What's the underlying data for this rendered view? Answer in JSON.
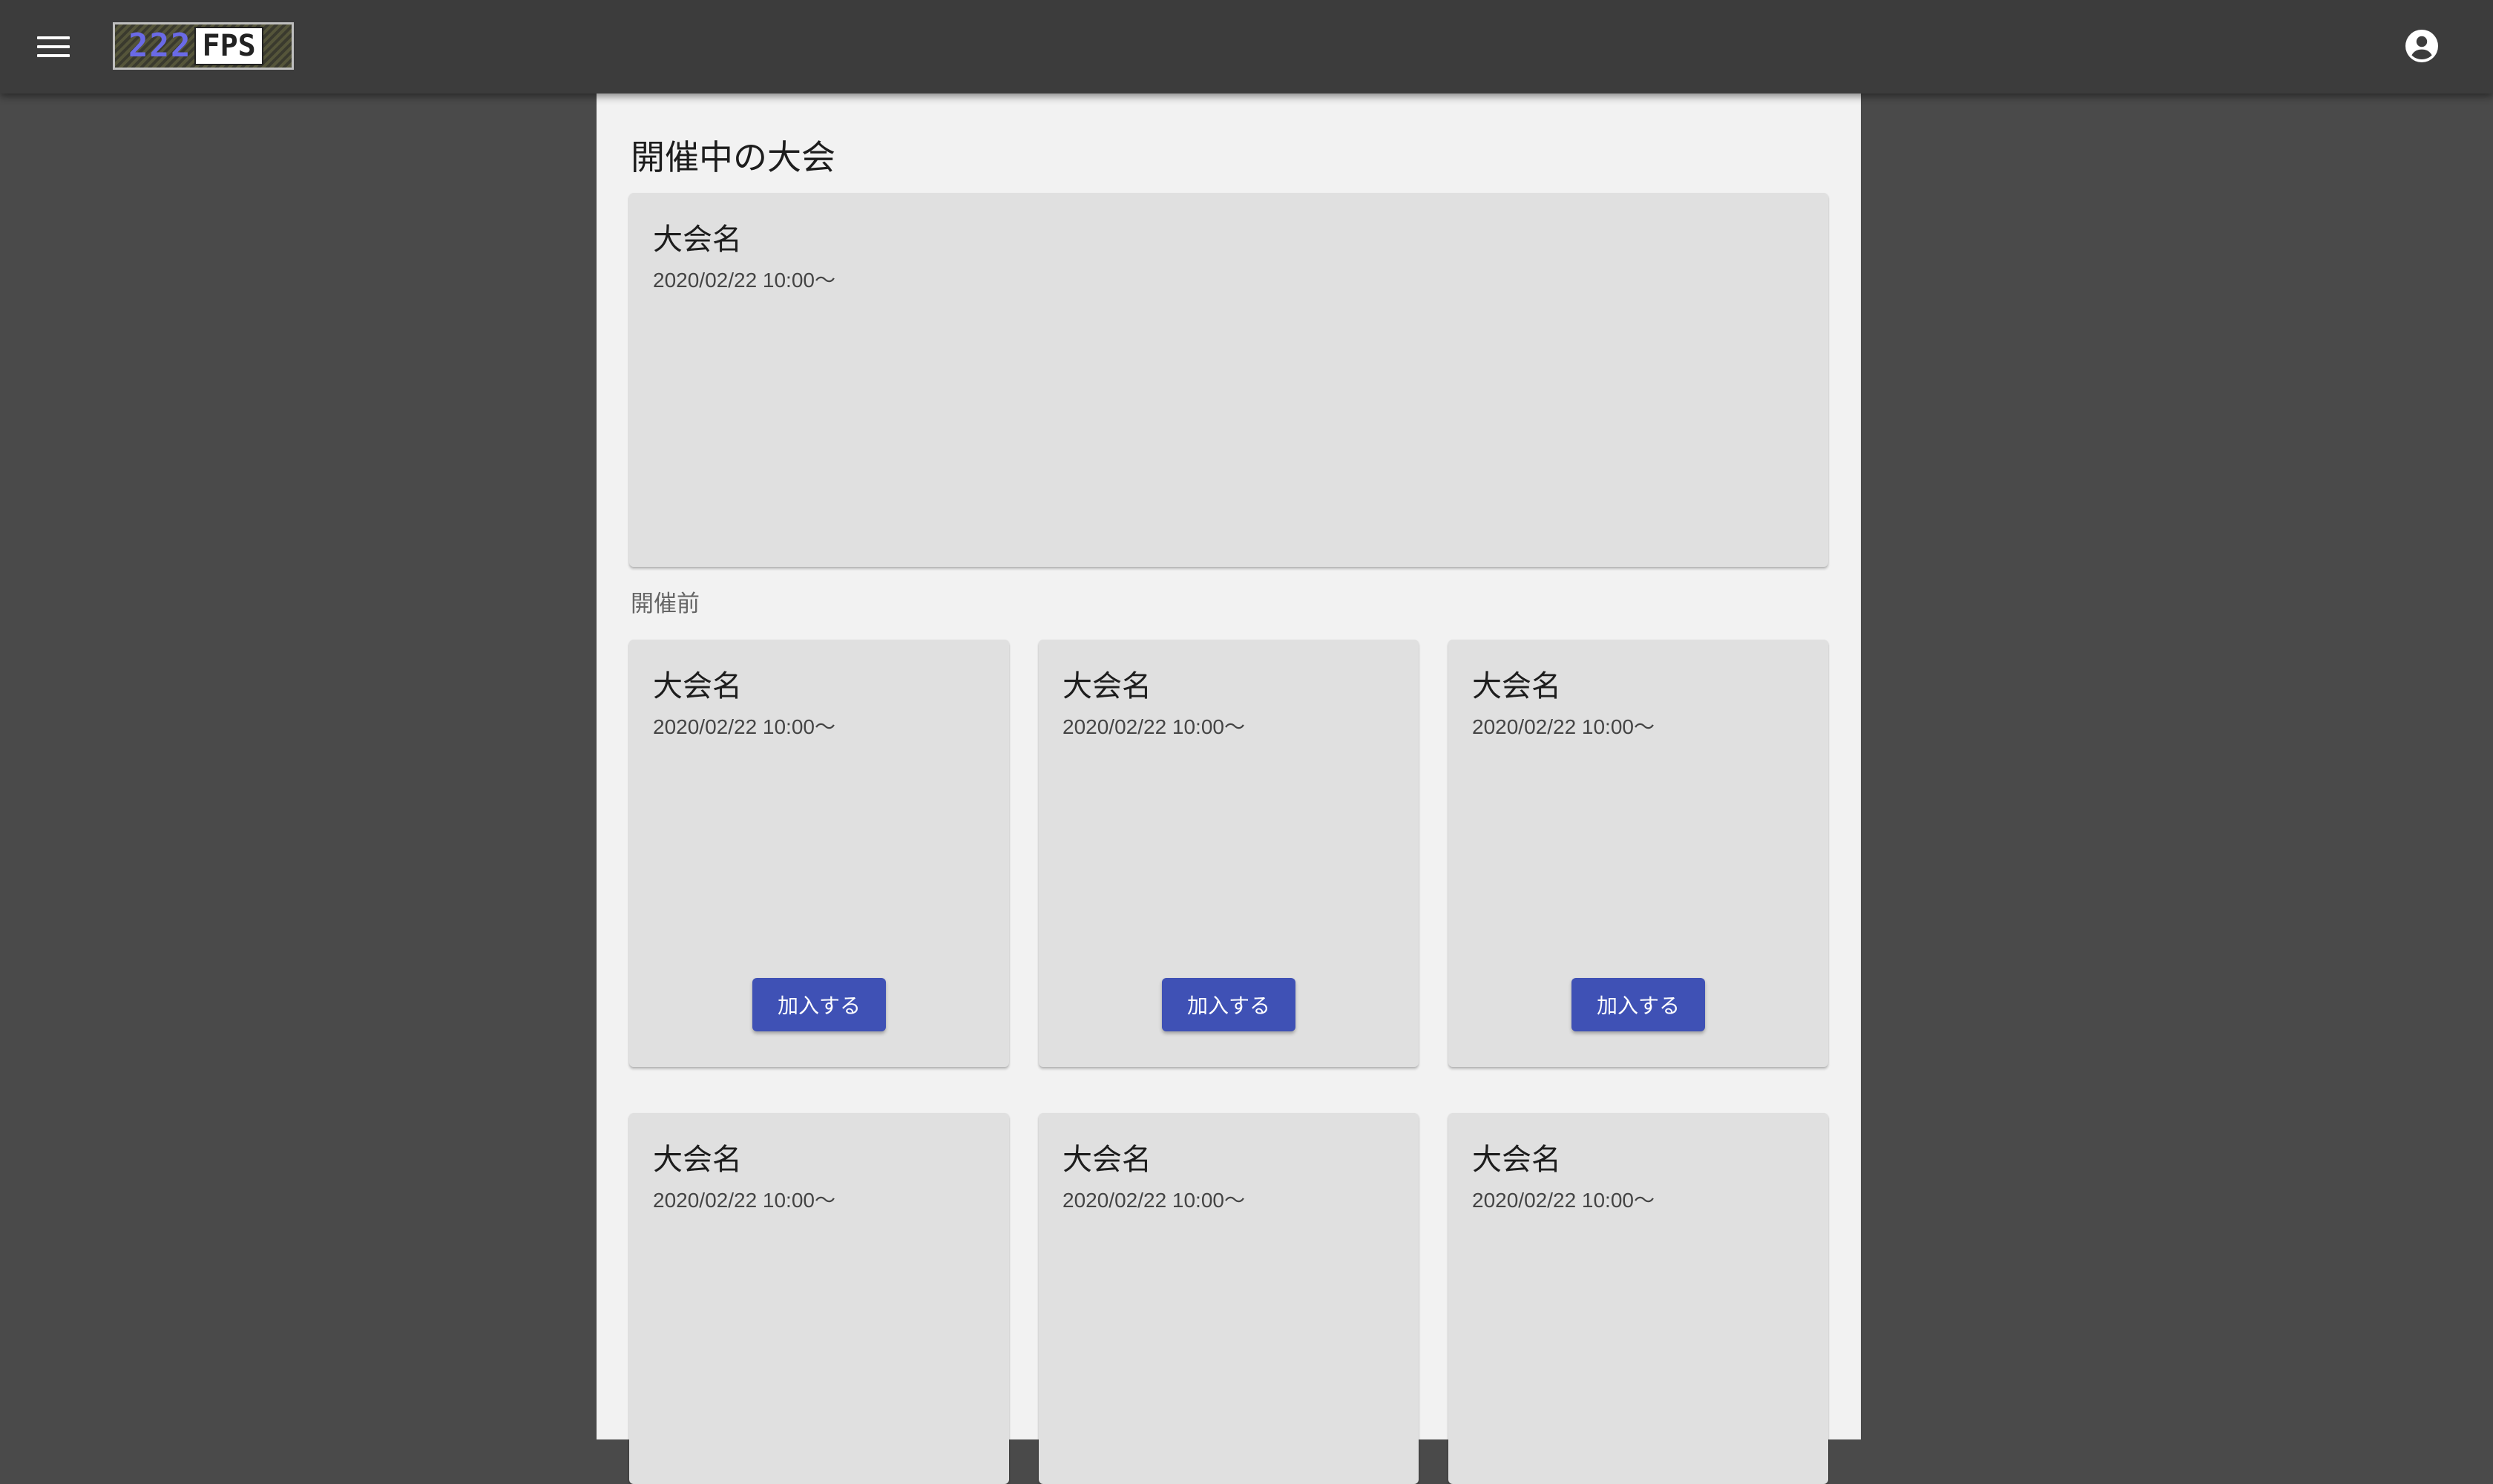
{
  "appbar": {
    "logo_number": "222",
    "logo_text": "FPS",
    "logo_colors": {
      "number": "#6a6ae6",
      "text_bg": "#ffffff"
    },
    "icons": {
      "menu": "menu-icon",
      "account": "account-circle-icon"
    }
  },
  "page": {
    "title": "開催中の大会",
    "ongoing": {
      "name": "大会名",
      "date": "2020/02/22 10:00～"
    },
    "upcoming_label": "開催前",
    "upcoming": [
      {
        "name": "大会名",
        "date": "2020/02/22 10:00～",
        "button": "加入する"
      },
      {
        "name": "大会名",
        "date": "2020/02/22 10:00～",
        "button": "加入する"
      },
      {
        "name": "大会名",
        "date": "2020/02/22 10:00～",
        "button": "加入する"
      },
      {
        "name": "大会名",
        "date": "2020/02/22 10:00～"
      },
      {
        "name": "大会名",
        "date": "2020/02/22 10:00～"
      },
      {
        "name": "大会名",
        "date": "2020/02/22 10:00～"
      }
    ]
  },
  "colors": {
    "appbar": "#3c3c3c",
    "background": "#4a4a4a",
    "content": "#f2f2f2",
    "card": "#e0e0e0",
    "primary_button": "#3f51b5"
  }
}
